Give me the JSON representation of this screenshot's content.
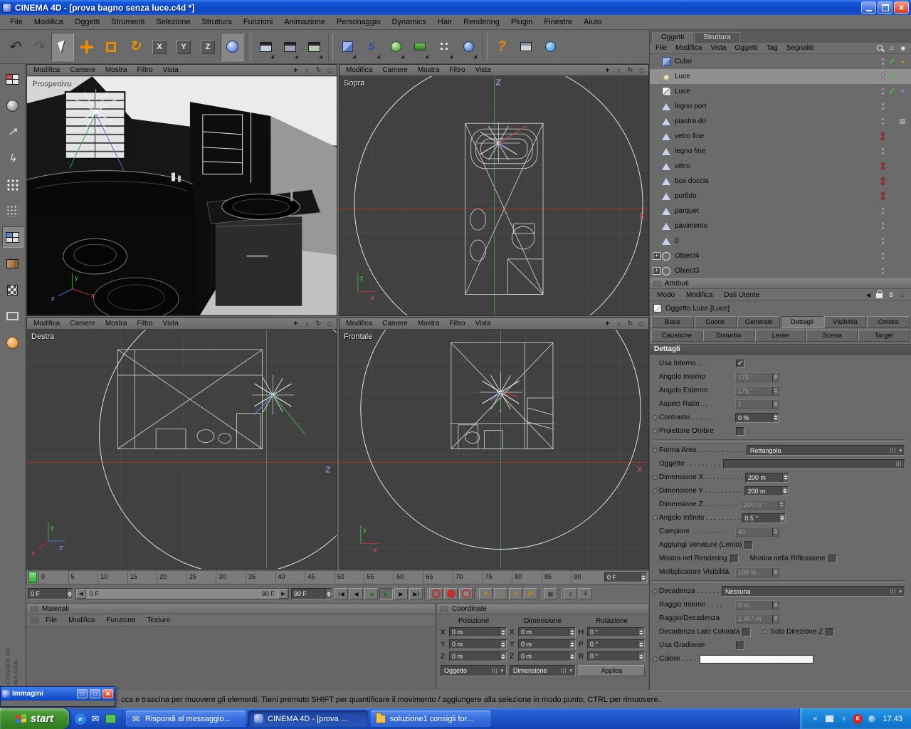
{
  "titlebar": {
    "title": "CINEMA 4D - [prova bagno senza luce.c4d *]"
  },
  "menubar": [
    "File",
    "Modifica",
    "Oggetti",
    "Strumenti",
    "Selezione",
    "Struttura",
    "Funzioni",
    "Animazione",
    "Personaggio",
    "Dynamics",
    "Hair",
    "Rendering",
    "Plugin",
    "Finestre",
    "Aiuto"
  ],
  "toolbar": [
    {
      "icon": "undo"
    },
    {
      "icon": "redo",
      "disabled": true
    },
    {
      "icon": "live-selection",
      "pressed": true
    },
    {
      "icon": "move"
    },
    {
      "icon": "scale"
    },
    {
      "icon": "rotate"
    },
    {
      "icon": "lock-x",
      "label": "X"
    },
    {
      "icon": "lock-y",
      "label": "Y"
    },
    {
      "icon": "lock-z",
      "label": "Z"
    },
    {
      "icon": "coordinate-system",
      "pressed": true
    },
    {
      "icon": "sep"
    },
    {
      "icon": "render-view"
    },
    {
      "icon": "render-settings"
    },
    {
      "icon": "render-batch"
    },
    {
      "icon": "sep"
    },
    {
      "icon": "add-primitive"
    },
    {
      "icon": "add-spline"
    },
    {
      "icon": "add-generator"
    },
    {
      "icon": "add-scene"
    },
    {
      "icon": "add-particle"
    },
    {
      "icon": "add-deformer"
    },
    {
      "icon": "sep"
    },
    {
      "icon": "help"
    },
    {
      "icon": "content-browser"
    },
    {
      "icon": "online-updater"
    }
  ],
  "sidebar": [
    {
      "icon": "viewport-layout"
    },
    {
      "icon": "render-sphere"
    },
    {
      "icon": "arrow-up"
    },
    {
      "icon": "corner-arrow"
    },
    {
      "icon": "array-grid"
    },
    {
      "icon": "point-grid"
    },
    {
      "icon": "window-panes",
      "pressed": true
    },
    {
      "icon": "color-cells"
    },
    {
      "icon": "checkerboard"
    },
    {
      "icon": "frame-box"
    },
    {
      "icon": "orange-sphere"
    }
  ],
  "viewport_menu": [
    "Modifica",
    "Camere",
    "Mostra",
    "Filtro",
    "Vista"
  ],
  "viewport_icons": [
    {
      "icon": "pan"
    },
    {
      "icon": "dolly"
    },
    {
      "icon": "rotate-view"
    },
    {
      "icon": "toggle-view"
    }
  ],
  "viewports": {
    "prospettiva": "Prospettiva",
    "sopra": "Sopra",
    "destra": "Destra",
    "frontale": "Frontale"
  },
  "axis": {
    "x": "X",
    "y": "Y",
    "z": "Z"
  },
  "gizmo": {
    "x": "x",
    "y": "y",
    "z": "z"
  },
  "object_manager": {
    "tabs": [
      {
        "label": "Oggetti",
        "active": true
      },
      {
        "label": "Struttura"
      }
    ],
    "menu": [
      "File",
      "Modifica",
      "Vista",
      "Oggetti",
      "Tag",
      "Segnalib"
    ],
    "header_icons": [
      {
        "icon": "search"
      },
      {
        "icon": "home"
      },
      {
        "icon": "eye"
      }
    ],
    "items": [
      {
        "label": "Cubo",
        "icon": "cube",
        "check": true,
        "tag": "dot"
      },
      {
        "label": "Luce",
        "icon": "light",
        "selected": true,
        "check": true
      },
      {
        "label": "Luce",
        "icon": "area-light",
        "check": true,
        "tag": "axis"
      },
      {
        "label": "legno port",
        "icon": "polygon"
      },
      {
        "label": "piastra do",
        "icon": "polygon",
        "tag": "film"
      },
      {
        "label": "vetro fine",
        "icon": "polygon",
        "dots": "red"
      },
      {
        "label": "legno fine",
        "icon": "polygon"
      },
      {
        "label": "vetro",
        "icon": "polygon",
        "dots": "red"
      },
      {
        "label": "box doccia",
        "icon": "polygon",
        "dots": "red"
      },
      {
        "label": "porfido",
        "icon": "polygon",
        "dots": "red"
      },
      {
        "label": "parquet",
        "icon": "polygon"
      },
      {
        "label": "pavimento",
        "icon": "polygon"
      },
      {
        "label": "0",
        "icon": "polygon"
      },
      {
        "label": "Object4",
        "icon": "null-object",
        "expandable": true
      },
      {
        "label": "Object3",
        "icon": "null-object",
        "expandable": true
      }
    ]
  },
  "attributes": {
    "panel_title": "Attributi",
    "mode_menu": [
      "Modo",
      "Modifica",
      "Dati Utente"
    ],
    "header_icons": [
      {
        "icon": "back"
      },
      {
        "icon": "lock"
      },
      {
        "icon": "link"
      },
      {
        "icon": "scroll"
      }
    ],
    "object_title": "Oggetto Luce [Luce]",
    "tabs_row1": [
      {
        "label": "Base"
      },
      {
        "label": "Coord."
      },
      {
        "label": "Generale"
      },
      {
        "label": "Dettagli",
        "active": true
      },
      {
        "label": "Visibilità"
      },
      {
        "label": "Ombra"
      }
    ],
    "tabs_row2": [
      {
        "label": "Caustiche"
      },
      {
        "label": "Disturbo"
      },
      {
        "label": "Lente"
      },
      {
        "label": "Scena"
      },
      {
        "label": "Target"
      }
    ],
    "section_title": "Dettagli",
    "params": [
      {
        "type": "checkbox",
        "label": "Usa Interno . . .",
        "checked": true
      },
      {
        "type": "spinner",
        "label": "Angolo Interno",
        "value": "175 °",
        "enabled": false
      },
      {
        "type": "spinner",
        "label": "Angolo Esterno",
        "value": "175 °",
        "enabled": false
      },
      {
        "type": "spinner",
        "label": "Aspect Ratio . .",
        "value": "1",
        "enabled": false
      },
      {
        "type": "spinner",
        "label": "Contrasto . . . . . .",
        "value": "0 %",
        "dot": true
      },
      {
        "type": "checkbox",
        "label": "Proiettore Ombre",
        "dot": true
      },
      {
        "type": "divider"
      },
      {
        "type": "dropdown",
        "label": "Forma Area . . . . . . . . . . . .",
        "value": "Rettangolo",
        "dot": true
      },
      {
        "type": "objectfield",
        "label": "Oggetto . . . . . . . . ."
      },
      {
        "type": "spinner",
        "label": "Dimensione X . . . . . . . . . .",
        "value": "200 m",
        "dot": true
      },
      {
        "type": "spinner",
        "label": "Dimensione Y . . . . . . . . . .",
        "value": "200 m",
        "dot": true
      },
      {
        "type": "spinner",
        "label": "Dimensione Z . . . . . . . . .",
        "value": "200 m",
        "enabled": false
      },
      {
        "type": "spinner",
        "label": "Angolo Infinito . . . . . . . . .",
        "value": "0.5 °",
        "dot": true
      },
      {
        "type": "spinner",
        "label": "Campioni . . . . . . . . .",
        "value": "40",
        "enabled": false
      },
      {
        "type": "checkbox",
        "label": "Aggiungi Venature (Lento)"
      },
      {
        "type": "checkbox2",
        "left": "Mostra nel Rendering",
        "right": "Mostra nella Riflessione"
      },
      {
        "type": "spinner",
        "label": "Moltiplicatore Visibilità",
        "value": "100 %",
        "enabled": false
      },
      {
        "type": "divider"
      },
      {
        "type": "dropdown",
        "label": "Decadenza . . . . . .",
        "value": "Nessuna",
        "dot": true
      },
      {
        "type": "spinner",
        "label": "Raggio Interno . . . .",
        "value": "0 m",
        "enabled": false
      },
      {
        "type": "spinner",
        "label": "Raggio/Decadenza",
        "value": "2.467 m",
        "enabled": false
      },
      {
        "type": "checkbox2",
        "left": "Decadenza Lato Colorata",
        "right": "Solo Direzione Z",
        "right_dot": true
      },
      {
        "type": "checkbox",
        "label": "Usa Gradiente"
      },
      {
        "type": "gradient",
        "label": "Colore . . . .",
        "dot": true
      }
    ]
  },
  "timeline": {
    "ticks": [
      "0",
      "5",
      "10",
      "15",
      "20",
      "25",
      "30",
      "35",
      "40",
      "45",
      "50",
      "55",
      "60",
      "65",
      "70",
      "75",
      "80",
      "85",
      "90"
    ],
    "ruler_frame": "0 F",
    "current_frame": "0 F",
    "range_start": "0 F",
    "range_end": "90 F",
    "end_frame": "90 F",
    "controls": [
      {
        "icon": "goto-start"
      },
      {
        "icon": "prev-key"
      },
      {
        "icon": "play-rev"
      },
      {
        "icon": "play",
        "pressed": true
      },
      {
        "icon": "next-key"
      },
      {
        "icon": "goto-end"
      },
      {
        "icon": "sep"
      },
      {
        "icon": "record-key"
      },
      {
        "icon": "record-auto"
      },
      {
        "icon": "record-opt"
      },
      {
        "icon": "sep"
      },
      {
        "icon": "mask-position"
      },
      {
        "icon": "mask-scale"
      },
      {
        "icon": "mask-rotation"
      },
      {
        "icon": "mask-param"
      },
      {
        "icon": "sep"
      },
      {
        "icon": "record-active"
      },
      {
        "icon": "sep"
      },
      {
        "icon": "sound"
      },
      {
        "icon": "timeline-mode"
      }
    ]
  },
  "materials": {
    "panel_title": "Materiali",
    "menu": [
      "File",
      "Modifica",
      "Funzione",
      "Texture"
    ]
  },
  "coordinates": {
    "panel_title": "Coordinate",
    "groups": [
      {
        "header": "Posizione",
        "rows": [
          {
            "k": "X",
            "v": "0 m"
          },
          {
            "k": "Y",
            "v": "0 m"
          },
          {
            "k": "Z",
            "v": "0 m"
          }
        ]
      },
      {
        "header": "Dimensione",
        "rows": [
          {
            "k": "X",
            "v": "0 m"
          },
          {
            "k": "Y",
            "v": "0 m"
          },
          {
            "k": "Z",
            "v": "0 m"
          }
        ]
      },
      {
        "header": "Rotazione",
        "rows": [
          {
            "k": "H",
            "v": "0 °"
          },
          {
            "k": "P",
            "v": "0 °"
          },
          {
            "k": "B",
            "v": "0 °"
          }
        ]
      }
    ],
    "dropdown_left": "Oggetto",
    "dropdown_mid": "Dimensione",
    "apply_label": "Applica"
  },
  "statusbar": {
    "text": "cca e trascina per muovere gli elementi. Tieni premuto SHIFT per quantificare il movimento / aggiungere alla selezione in modo punto, CTRL per rimuovere."
  },
  "immagini": {
    "title": "Immagini"
  },
  "maxon": {
    "line1": "MAXON",
    "line2": "CINEMA 4D"
  },
  "taskbar": {
    "start_label": "start",
    "quick_launch": [
      {
        "icon": "ie"
      },
      {
        "icon": "mail"
      },
      {
        "icon": "desktop"
      }
    ],
    "tasks": [
      {
        "icon": "mail",
        "label": "Rispondi al messaggio..."
      },
      {
        "icon": "c4d",
        "label": "CINEMA 4D - [prova ...",
        "active": true
      },
      {
        "icon": "folder",
        "label": "soluzione1 consigli for..."
      }
    ],
    "tray_icons": [
      {
        "icon": "chevron"
      },
      {
        "icon": "display"
      },
      {
        "icon": "volume"
      },
      {
        "icon": "antivirus"
      },
      {
        "icon": "updates"
      }
    ],
    "clock": "17.43"
  }
}
